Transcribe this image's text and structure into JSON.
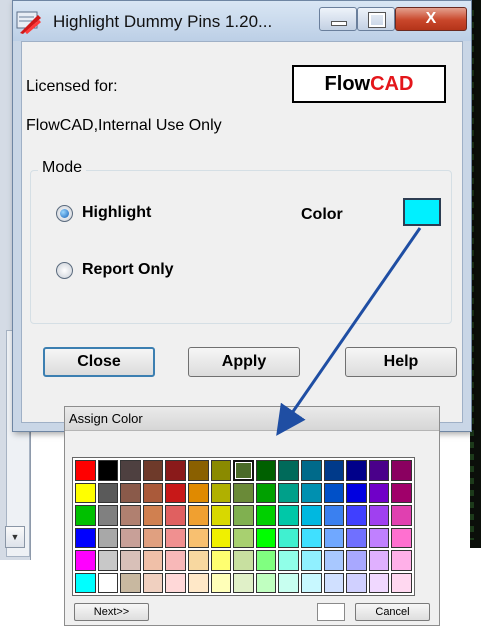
{
  "main_dialog": {
    "title": "Highlight Dummy Pins 1.20...",
    "window_controls": {
      "close_symbol": "X"
    },
    "licensed_label": "Licensed for:",
    "logo": {
      "part1": "Flow",
      "part2": "CAD",
      "part1_color": "#000000",
      "part2_color": "#e4161b"
    },
    "licensee": "FlowCAD,Internal Use Only",
    "mode": {
      "legend": "Mode",
      "options": [
        {
          "label": "Highlight",
          "selected": true
        },
        {
          "label": "Report Only",
          "selected": false
        }
      ],
      "color_label": "Color",
      "color_value": "#00f0ff"
    },
    "buttons": {
      "close": "Close",
      "apply": "Apply",
      "help": "Help"
    }
  },
  "assign_color_dialog": {
    "title": "Assign Color",
    "palette_rows": [
      [
        "#ff0000",
        "#000000",
        "#4e4040",
        "#6e3a2a",
        "#8a1a1a",
        "#8a6000",
        "#8a8a00",
        "#4a6a28",
        "#006000",
        "#006a5a",
        "#006a8a",
        "#003a8a",
        "#00008a",
        "#4a008a",
        "#8a0060"
      ],
      [
        "#ffff00",
        "#5a5a5a",
        "#8a5a4a",
        "#aa5a3a",
        "#c81818",
        "#e08a00",
        "#b0b000",
        "#6a8a38",
        "#00a000",
        "#00a08a",
        "#0090b0",
        "#0050c8",
        "#0000e0",
        "#7000c8",
        "#a0006a"
      ],
      [
        "#00c000",
        "#808080",
        "#b08070",
        "#d08050",
        "#e06060",
        "#f0a030",
        "#d8d800",
        "#80b050",
        "#00d000",
        "#00c8a8",
        "#00b8e0",
        "#3a80f0",
        "#4040ff",
        "#a040f0",
        "#e040b0"
      ],
      [
        "#0000ff",
        "#a8a8a8",
        "#c8a098",
        "#e0a080",
        "#f09090",
        "#f8c070",
        "#f0f000",
        "#a8d070",
        "#00ff00",
        "#40f0d0",
        "#40e0ff",
        "#70a8ff",
        "#7070ff",
        "#c080ff",
        "#ff70d0"
      ],
      [
        "#ff00ff",
        "#c8c8c8",
        "#d8c0b8",
        "#f0c0a8",
        "#f8b8b8",
        "#f8d8a0",
        "#ffff70",
        "#c8e0a0",
        "#80ff80",
        "#90ffe8",
        "#90f0ff",
        "#a8c8ff",
        "#a8a8ff",
        "#e0b0ff",
        "#ffb0e8"
      ],
      [
        "#00ffff",
        "#ffffff",
        "#c8b8a0",
        "#f0d0c0",
        "#ffd8d8",
        "#ffe8c8",
        "#ffffb8",
        "#e0f0c8",
        "#c0ffc0",
        "#c8fff0",
        "#c8f8ff",
        "#d0e0ff",
        "#d0d0ff",
        "#f0d8ff",
        "#ffd8f0"
      ]
    ],
    "selected_swatch": {
      "row": 0,
      "col": 7
    },
    "next_label": "Next>>",
    "cancel_label": "Cancel",
    "current_color": "#ffffff"
  }
}
